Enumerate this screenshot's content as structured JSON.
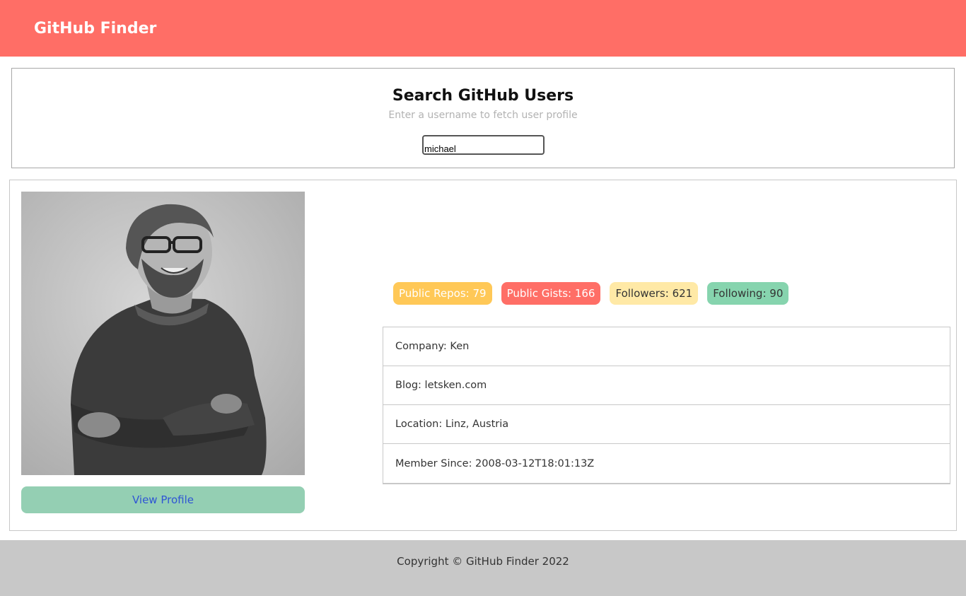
{
  "navbar": {
    "brand": "GitHub Finder",
    "color": "#ff6e66"
  },
  "search": {
    "title": "Search GitHub Users",
    "subtitle": "Enter a username to fetch user profile",
    "value": "michael"
  },
  "profile": {
    "avatar_icon": "user-photo",
    "view_profile_label": "View Profile",
    "badges": {
      "repos": "Public Repos: 79",
      "gists": "Public Gists: 166",
      "followers": "Followers: 621",
      "following": "Following: 90"
    },
    "details": {
      "company": "Company: Ken",
      "blog": "Blog: letsken.com",
      "location": "Location: Linz, Austria",
      "member_since": "Member Since: 2008-03-12T18:01:13Z"
    }
  },
  "footer": {
    "copyright": "Copyright © GitHub Finder 2022"
  }
}
